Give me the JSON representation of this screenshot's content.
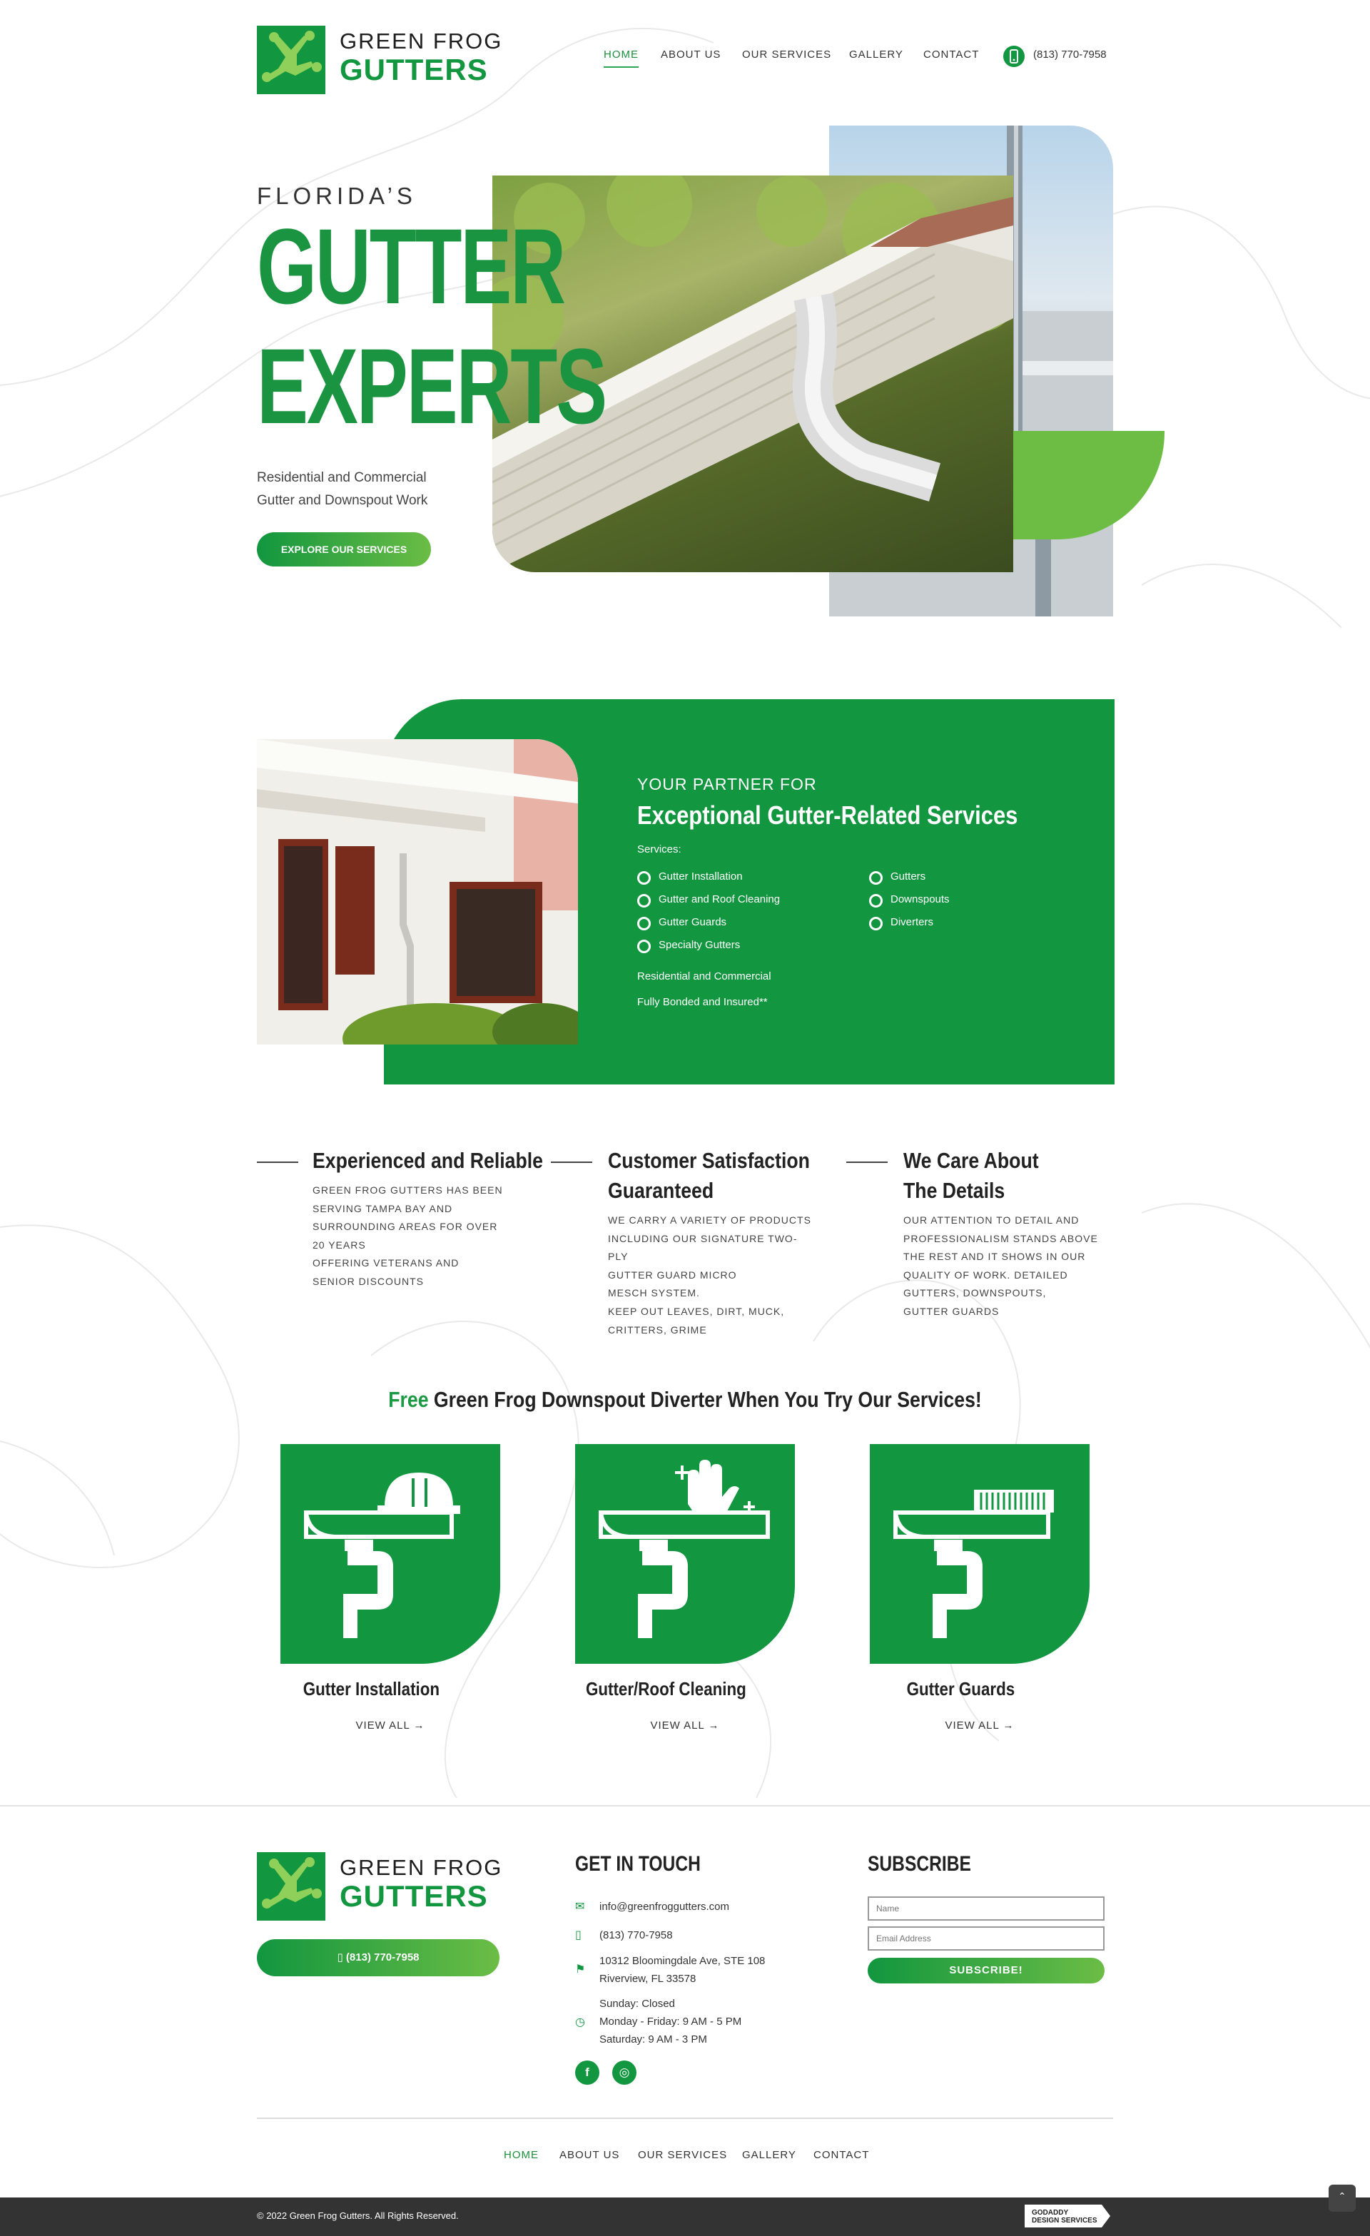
{
  "brand": {
    "line1": "GREEN FROG",
    "line2": "GUTTERS",
    "green": "#12963f",
    "light_green": "#6bbd45"
  },
  "nav": {
    "home": "HOME",
    "about": "ABOUT US",
    "services": "OUR SERVICES",
    "gallery": "GALLERY",
    "contact": "CONTACT",
    "phone": "(813) 770-7958"
  },
  "hero": {
    "pre": "FLORIDA’S",
    "line1": "GUTTER",
    "line2": "EXPERTS",
    "desc_line1": "Residential and Commercial",
    "desc_line2": "Gutter and Downspout Work",
    "cta": "EXPLORE OUR SERVICES"
  },
  "partner": {
    "pre": "YOUR PARTNER FOR",
    "title": "Exceptional Gutter-Related Services",
    "services_label": "Services:",
    "col1": [
      "Gutter Installation",
      "Gutter and Roof Cleaning",
      "Gutter Guards",
      "Specialty Gutters"
    ],
    "col2": [
      "Gutters",
      "Downspouts",
      "Diverters"
    ],
    "note1": "Residential and Commercial",
    "note2": "Fully Bonded and Insured**"
  },
  "features": [
    {
      "title1": "Experienced and Reliable",
      "title2": "",
      "lines": [
        "GREEN FROG GUTTERS HAS BEEN",
        "SERVING TAMPA BAY AND",
        "SURROUNDING AREAS FOR OVER",
        "20 YEARS",
        "OFFERING VETERANS AND",
        "SENIOR DISCOUNTS"
      ]
    },
    {
      "title1": "Customer Satisfaction",
      "title2": "Guaranteed",
      "lines": [
        "WE CARRY A VARIETY OF PRODUCTS",
        "INCLUDING OUR SIGNATURE TWO-PLY",
        "GUTTER GUARD MICRO",
        "MESCH SYSTEM.",
        "KEEP OUT LEAVES, DIRT, MUCK,",
        "CRITTERS, GRIME"
      ]
    },
    {
      "title1": "We Care About",
      "title2": "The Details",
      "lines": [
        "OUR ATTENTION TO DETAIL AND",
        "PROFESSIONALISM STANDS ABOVE",
        "THE REST AND IT SHOWS IN OUR",
        "QUALITY OF WORK. DETAILED",
        "GUTTERS, DOWNSPOUTS,",
        "GUTTER GUARDS"
      ]
    }
  ],
  "promo": {
    "free": "Free",
    "rest": " Green Frog Downspout Diverter When You Try Our Services!"
  },
  "cards": [
    {
      "title": "Gutter Installation",
      "link": "VIEW ALL",
      "icon": "hard-hat-icon"
    },
    {
      "title": "Gutter/Roof Cleaning",
      "link": "VIEW ALL",
      "icon": "clean-glove-icon"
    },
    {
      "title": "Gutter Guards",
      "link": "VIEW ALL",
      "icon": "gutter-guard-icon"
    }
  ],
  "footer": {
    "phone_btn": "(813) 770-7958",
    "contact_head": "GET IN TOUCH",
    "email": "info@greenfroggutters.com",
    "phone": "(813) 770-7958",
    "address1": "10312 Bloomingdale Ave, STE 108",
    "address2": "Riverview, FL 33578",
    "hours1": "Sunday: Closed",
    "hours2": "Monday - Friday: 9 AM - 5 PM",
    "hours3": "Saturday: 9 AM - 3 PM",
    "subscribe_head": "SUBSCRIBE",
    "name_placeholder": "Name",
    "email_placeholder": "Email Address",
    "subscribe_btn": "SUBSCRIBE!",
    "nav": [
      "HOME",
      "ABOUT US",
      "OUR SERVICES",
      "GALLERY",
      "CONTACT"
    ],
    "copyright": "© 2022 Green Frog Gutters. All Rights Reserved.",
    "badge1": "GODADDY",
    "badge2": "DESIGN SERVICES"
  }
}
